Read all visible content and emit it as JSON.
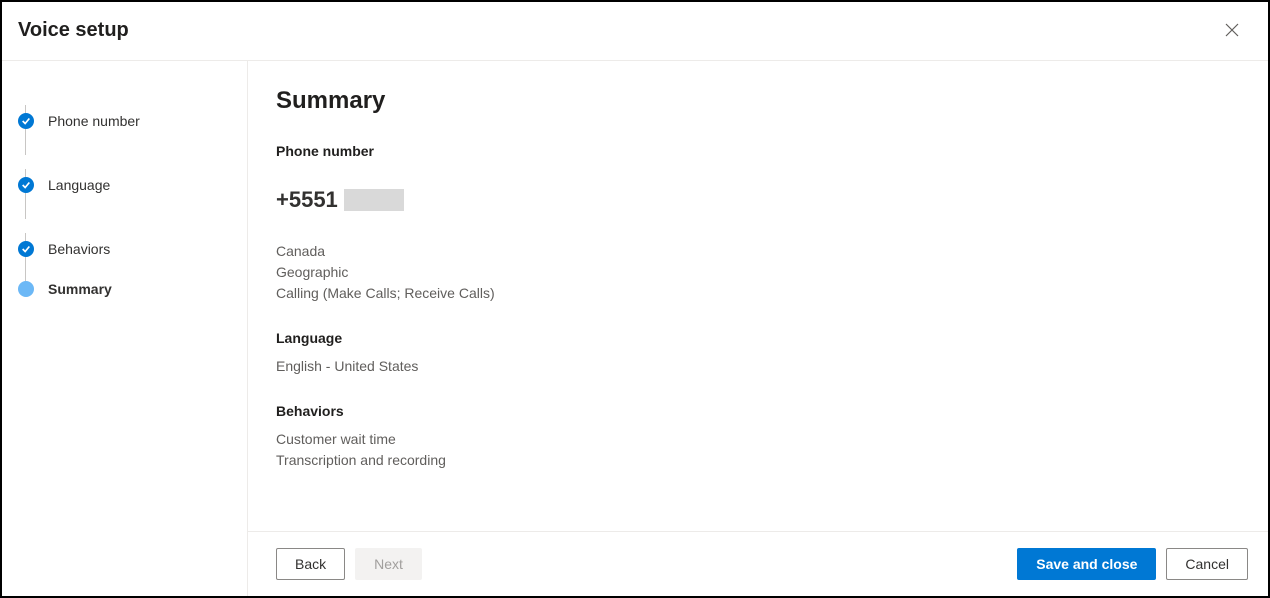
{
  "header": {
    "title": "Voice setup"
  },
  "sidebar": {
    "steps": [
      {
        "label": "Phone number",
        "state": "completed"
      },
      {
        "label": "Language",
        "state": "completed"
      },
      {
        "label": "Behaviors",
        "state": "completed"
      },
      {
        "label": "Summary",
        "state": "current"
      }
    ]
  },
  "summary": {
    "heading": "Summary",
    "phone_section_label": "Phone number",
    "phone_value": "+5551",
    "phone_details": {
      "country": "Canada",
      "type": "Geographic",
      "capabilities": "Calling (Make Calls; Receive Calls)"
    },
    "language_section_label": "Language",
    "language_value": "English - United States",
    "behaviors_section_label": "Behaviors",
    "behaviors": [
      "Customer wait time",
      "Transcription and recording"
    ]
  },
  "footer": {
    "back": "Back",
    "next": "Next",
    "save": "Save and close",
    "cancel": "Cancel"
  }
}
